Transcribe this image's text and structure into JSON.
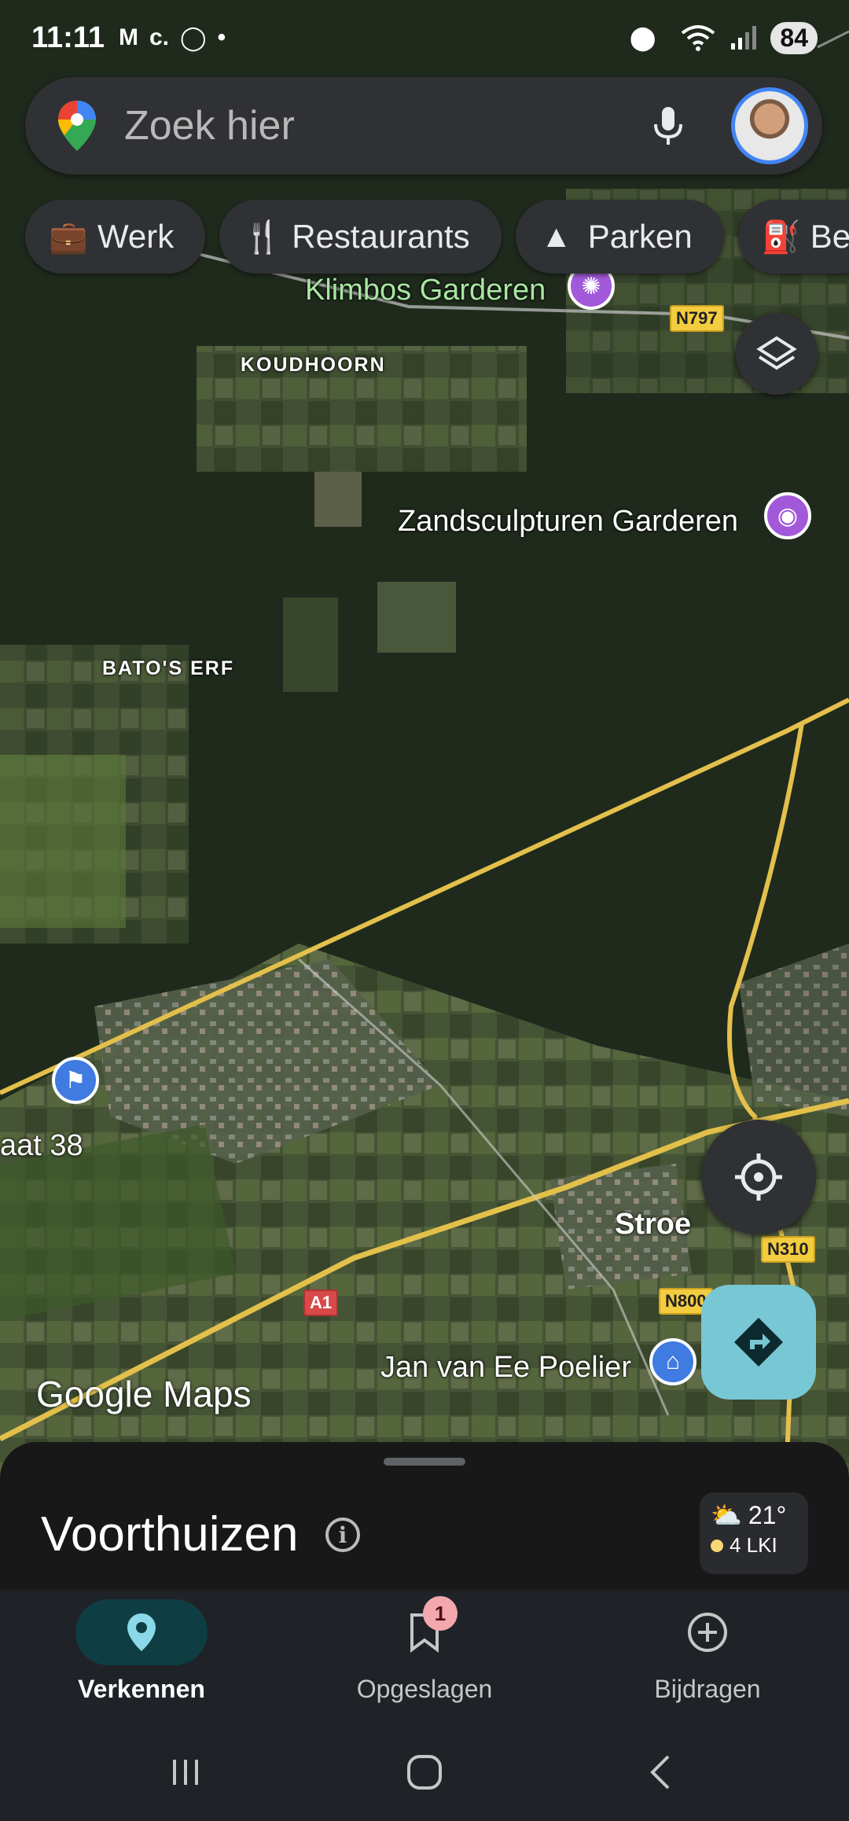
{
  "status_bar": {
    "time": "11:11",
    "left_icons": [
      "gmail-icon",
      "c-icon",
      "chat-bubble-icon",
      "dot-icon"
    ],
    "right_icons": [
      "location-icon",
      "wifi-icon",
      "signal-icon"
    ],
    "battery": "84"
  },
  "search": {
    "placeholder": "Zoek hier",
    "icons": [
      "maps-pin-logo",
      "mic-icon",
      "avatar"
    ]
  },
  "chips": [
    {
      "label": "Werk",
      "icon": "briefcase-icon"
    },
    {
      "label": "Restaurants",
      "icon": "fork-knife-icon"
    },
    {
      "label": "Parken",
      "icon": "tree-icon"
    },
    {
      "label": "Ben",
      "icon": "fuel-pump-icon"
    }
  ],
  "map": {
    "poi_labels": {
      "klimbos": "Klimbos Garderen",
      "zandsculpturen": "Zandsculpturen Garderen",
      "jan_van_ee": "Jan van Ee Poelier",
      "straat": "aat 38"
    },
    "area_labels": {
      "koudhoorn": "KOUDHOORN",
      "batos_erf": "BATO'S ERF"
    },
    "town_labels": {
      "stroe": "Stroe"
    },
    "road_shields": {
      "n797": "N797",
      "n310": "N310",
      "n800": "N800",
      "a1": "A1"
    },
    "logo": "Google Maps"
  },
  "sheet": {
    "place": "Voorthuizen",
    "weather": {
      "temp": "21°",
      "air_quality": "4 LKI",
      "icon": "partly-cloudy-icon"
    }
  },
  "bottom_nav": [
    {
      "label": "Verkennen",
      "icon": "location-pin-icon",
      "active": true
    },
    {
      "label": "Opgeslagen",
      "icon": "bookmark-icon",
      "badge": "1"
    },
    {
      "label": "Bijdragen",
      "icon": "add-circle-icon"
    }
  ],
  "colors": {
    "accent_teal": "#78c7d4",
    "nav_active": "#0f3d44",
    "road": "#e3c04b",
    "poi_purple": "#a259d9",
    "poi_blue": "#3f7be0"
  }
}
